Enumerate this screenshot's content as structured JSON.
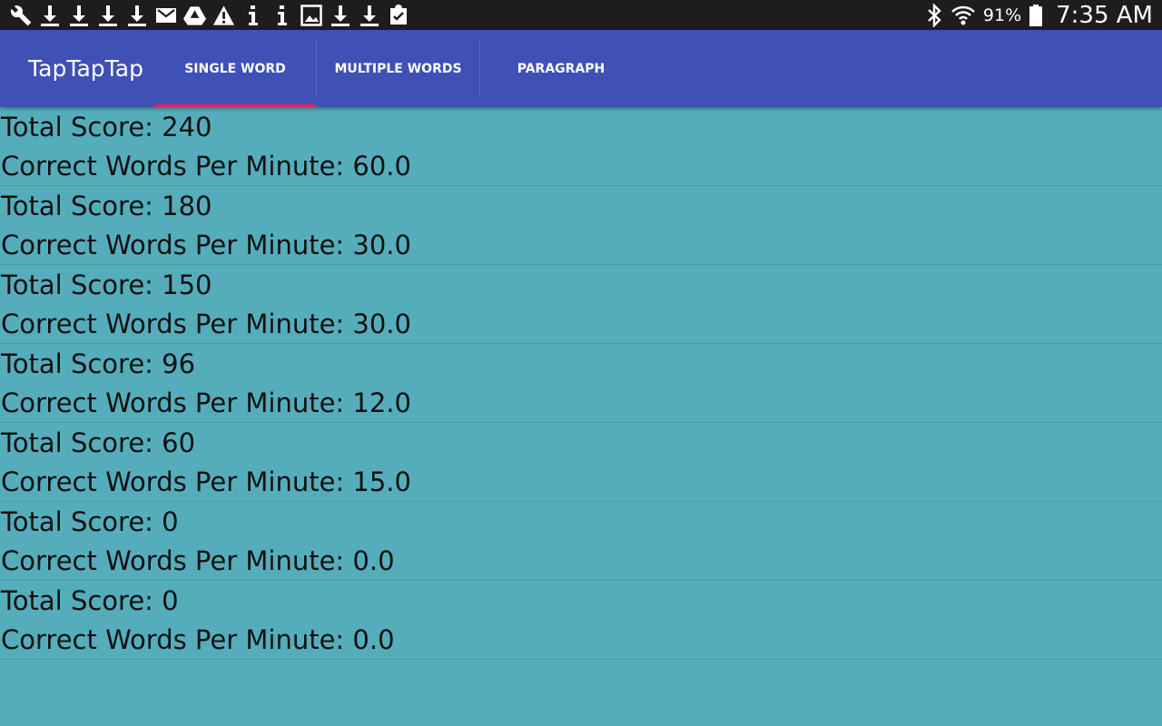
{
  "status_bar": {
    "left_icons": [
      "wrench-icon",
      "download-icon",
      "download-icon",
      "download-icon",
      "download-icon",
      "gmail-icon",
      "drive-icon",
      "warning-icon",
      "info-icon",
      "info-icon",
      "image-icon",
      "download-icon",
      "download-icon",
      "clipboard-check-icon"
    ],
    "battery_percent": "91%",
    "time": "7:35 AM"
  },
  "app_bar": {
    "title": "TapTapTap",
    "tabs": [
      {
        "label": "SINGLE WORD",
        "selected": true
      },
      {
        "label": "MULTIPLE WORDS",
        "selected": false
      },
      {
        "label": "PARAGRAPH",
        "selected": false
      }
    ]
  },
  "results": [
    {
      "total_score": "Total Score: 240",
      "wpm": "Correct Words Per Minute: 60.0"
    },
    {
      "total_score": "Total Score: 180",
      "wpm": "Correct Words Per Minute: 30.0"
    },
    {
      "total_score": "Total Score: 150",
      "wpm": "Correct Words Per Minute: 30.0"
    },
    {
      "total_score": "Total Score: 96",
      "wpm": "Correct Words Per Minute: 12.0"
    },
    {
      "total_score": "Total Score: 60",
      "wpm": "Correct Words Per Minute: 15.0"
    },
    {
      "total_score": "Total Score: 0",
      "wpm": "Correct Words Per Minute: 0.0"
    },
    {
      "total_score": "Total Score: 0",
      "wpm": "Correct Words Per Minute: 0.0"
    }
  ],
  "colors": {
    "status_bar": "#1d1d1d",
    "app_bar": "#3f51b5",
    "tab_indicator": "#e91e63",
    "background": "#55adbc"
  }
}
